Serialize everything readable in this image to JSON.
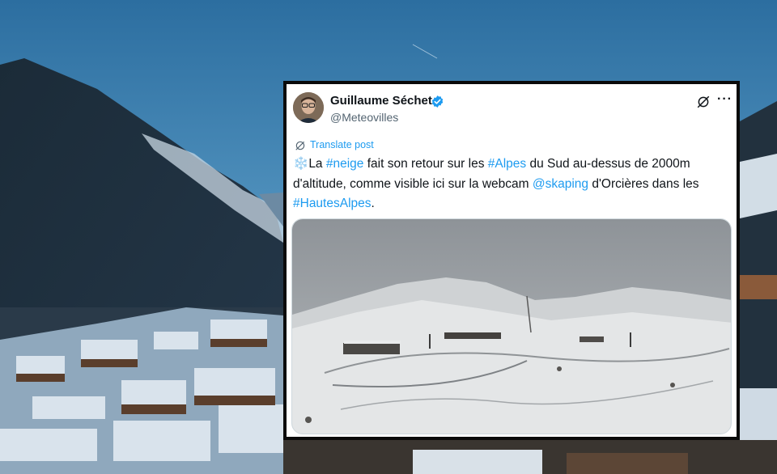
{
  "tweet": {
    "author_name": "Guillaume Séchet",
    "handle": "@Meteovilles",
    "translate_label": "Translate post",
    "text": {
      "emoji": "❄️",
      "p1": "La ",
      "h1": "#neige",
      "p2": " fait son retour sur les ",
      "h2": "#Alpes",
      "p3": " du Sud au-dessus de 2000m d'altitude, comme visible ici sur la webcam ",
      "h3": "@skaping",
      "p4": " d'Orcières dans les ",
      "h4": "#HautesAlpes",
      "p5": "."
    }
  },
  "icons": {
    "verified": "verified-badge-icon",
    "grok": "grok-icon",
    "more": "more-options-icon",
    "translate": "translate-icon"
  },
  "colors": {
    "link": "#1d9bf0",
    "text": "#0f1419",
    "secondary": "#536471",
    "card_border": "#0a0a0a"
  }
}
